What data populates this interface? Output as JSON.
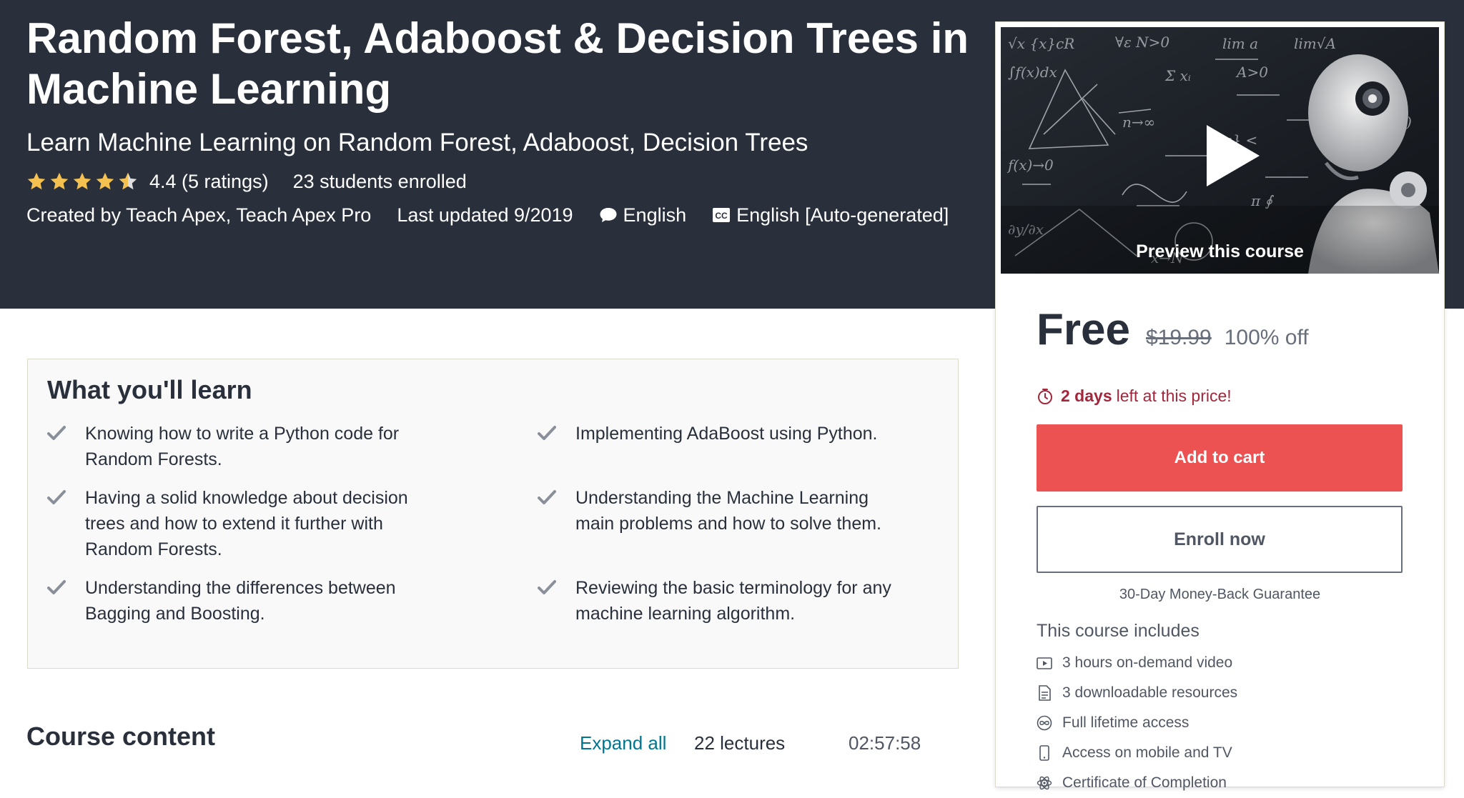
{
  "course": {
    "title": "Random Forest, Adaboost & Decision Trees in Machine Learning",
    "subtitle": "Learn Machine Learning on Random Forest, Adaboost, Decision Trees",
    "rating": 4.4,
    "rating_text": "4.4 (5 ratings)",
    "students": "23 students enrolled",
    "created_by": "Created by Teach Apex, Teach Apex Pro",
    "last_updated": "Last updated 9/2019",
    "language": "English",
    "captions": "English [Auto-generated]"
  },
  "preview": {
    "label": "Preview this course"
  },
  "pricing": {
    "price": "Free",
    "original_price": "$19.99",
    "discount": "100% off",
    "timer_bold": "2 days",
    "timer_rest": "left at this price!",
    "add_to_cart": "Add to cart",
    "enroll_now": "Enroll now",
    "guarantee": "30-Day Money-Back Guarantee"
  },
  "includes": {
    "title": "This course includes",
    "items": [
      {
        "icon": "video-icon",
        "label": "3 hours on-demand video"
      },
      {
        "icon": "file-icon",
        "label": "3 downloadable resources"
      },
      {
        "icon": "infinity-icon",
        "label": "Full lifetime access"
      },
      {
        "icon": "mobile-icon",
        "label": "Access on mobile and TV"
      },
      {
        "icon": "certificate-icon",
        "label": "Certificate of Completion"
      }
    ]
  },
  "learn": {
    "title": "What you'll learn",
    "items": [
      "Knowing how to write a Python code for Random Forests.",
      "Implementing AdaBoost using Python.",
      "Having a solid knowledge about decision trees and how to extend it further with Random Forests.",
      "Understanding the Machine Learning main problems and how to solve them.",
      "Understanding the differences between Bagging and Boosting.",
      "Reviewing the basic terminology for any machine learning algorithm."
    ]
  },
  "content": {
    "title": "Course content",
    "expand_all": "Expand all",
    "lectures": "22 lectures",
    "duration": "02:57:58"
  },
  "colors": {
    "hero_bg": "#29303b",
    "accent_red": "#ec5252",
    "star": "#f4c150",
    "link": "#007791",
    "timer": "#a1283c"
  }
}
